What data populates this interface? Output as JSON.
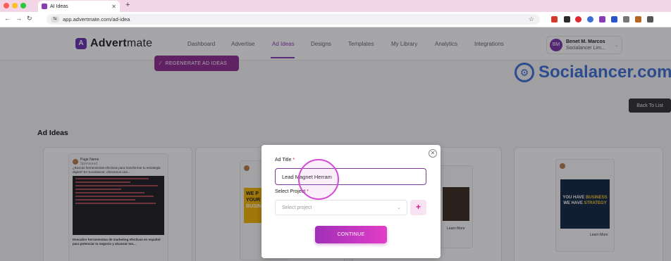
{
  "browser": {
    "tab_title": "AI Ideas",
    "url": "app.advertmate.com/ad-idea"
  },
  "header": {
    "logo_bold": "Advert",
    "logo_thin": "mate",
    "nav": [
      "Dashboard",
      "Advertise",
      "Ad Ideas",
      "Designs",
      "Templates",
      "My Library",
      "Analytics",
      "Integrations"
    ],
    "active_nav": "Ad Ideas",
    "user": {
      "initials": "BM",
      "name": "Benet M. Marcos",
      "company": "Socialancer Lim..."
    }
  },
  "page": {
    "regenerate_label": "REGENERATE AD IDEAS",
    "watermark": "Socialancer.com",
    "back_label": "Back To List",
    "section_title": "Ad Ideas",
    "cards": [
      {
        "page_name": "Page Name",
        "sponsored": "Sponsored",
        "text": "¿Buscas herramientas efectivas para transformar tu estrategia digital? En Socialancer, ofrecemos una...",
        "caption": "Descubre herramientas de marketing efectivas en español para potenciar tu negocio y alcanzar tus..."
      },
      {
        "headline_a": "WE P",
        "headline_b": "YOUR",
        "headline_c": "BUSIN"
      },
      {
        "btn": "Learn More"
      },
      {
        "poster_line1": "YOU HAVE ",
        "poster_hl1": "BUSINESS",
        "poster_line2": "WE HAVE ",
        "poster_hl2": "STRATEGY",
        "btn": "Learn More"
      }
    ]
  },
  "modal": {
    "ad_title_label": "Ad Title",
    "ad_title_value": "Lead Magnet Herram",
    "project_label": "Select Project",
    "project_placeholder": "Select project",
    "add_symbol": "+",
    "continue_label": "CONTINUE",
    "required_mark": "*"
  },
  "colors": {
    "brand": "#8a3bb8",
    "accent": "#e23dc8",
    "watermark": "#3b6fd6"
  }
}
